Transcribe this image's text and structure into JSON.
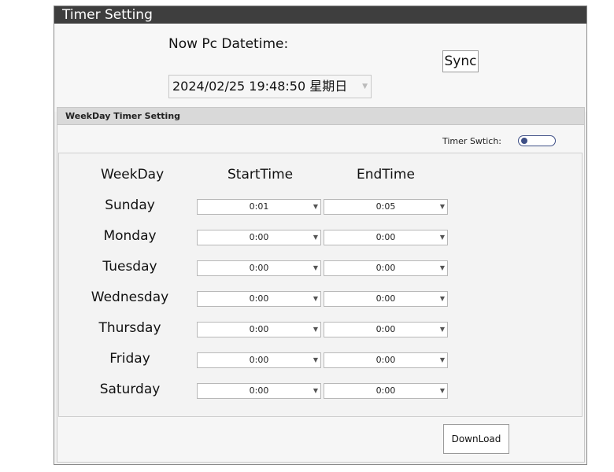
{
  "window": {
    "title": "Timer Setting"
  },
  "top": {
    "now_label": "Now Pc Datetime:",
    "datetime_value": "2024/02/25 19:48:50 星期日",
    "sync_label": "Sync"
  },
  "group": {
    "title": "WeekDay Timer Setting",
    "switch_label": "Timer Swtich:",
    "switch_on": false,
    "columns": [
      "WeekDay",
      "StartTime",
      "EndTime"
    ],
    "rows": [
      {
        "day": "Sunday",
        "start": "0:01",
        "end": "0:05"
      },
      {
        "day": "Monday",
        "start": "0:00",
        "end": "0:00"
      },
      {
        "day": "Tuesday",
        "start": "0:00",
        "end": "0:00"
      },
      {
        "day": "Wednesday",
        "start": "0:00",
        "end": "0:00"
      },
      {
        "day": "Thursday",
        "start": "0:00",
        "end": "0:00"
      },
      {
        "day": "Friday",
        "start": "0:00",
        "end": "0:00"
      },
      {
        "day": "Saturday",
        "start": "0:00",
        "end": "0:00"
      }
    ],
    "download_label": "DownLoad"
  },
  "icons": {
    "dropdown": "chevron-down-icon"
  },
  "colors": {
    "titlebar": "#3e3e3e",
    "switch_accent": "#3e4f86"
  }
}
